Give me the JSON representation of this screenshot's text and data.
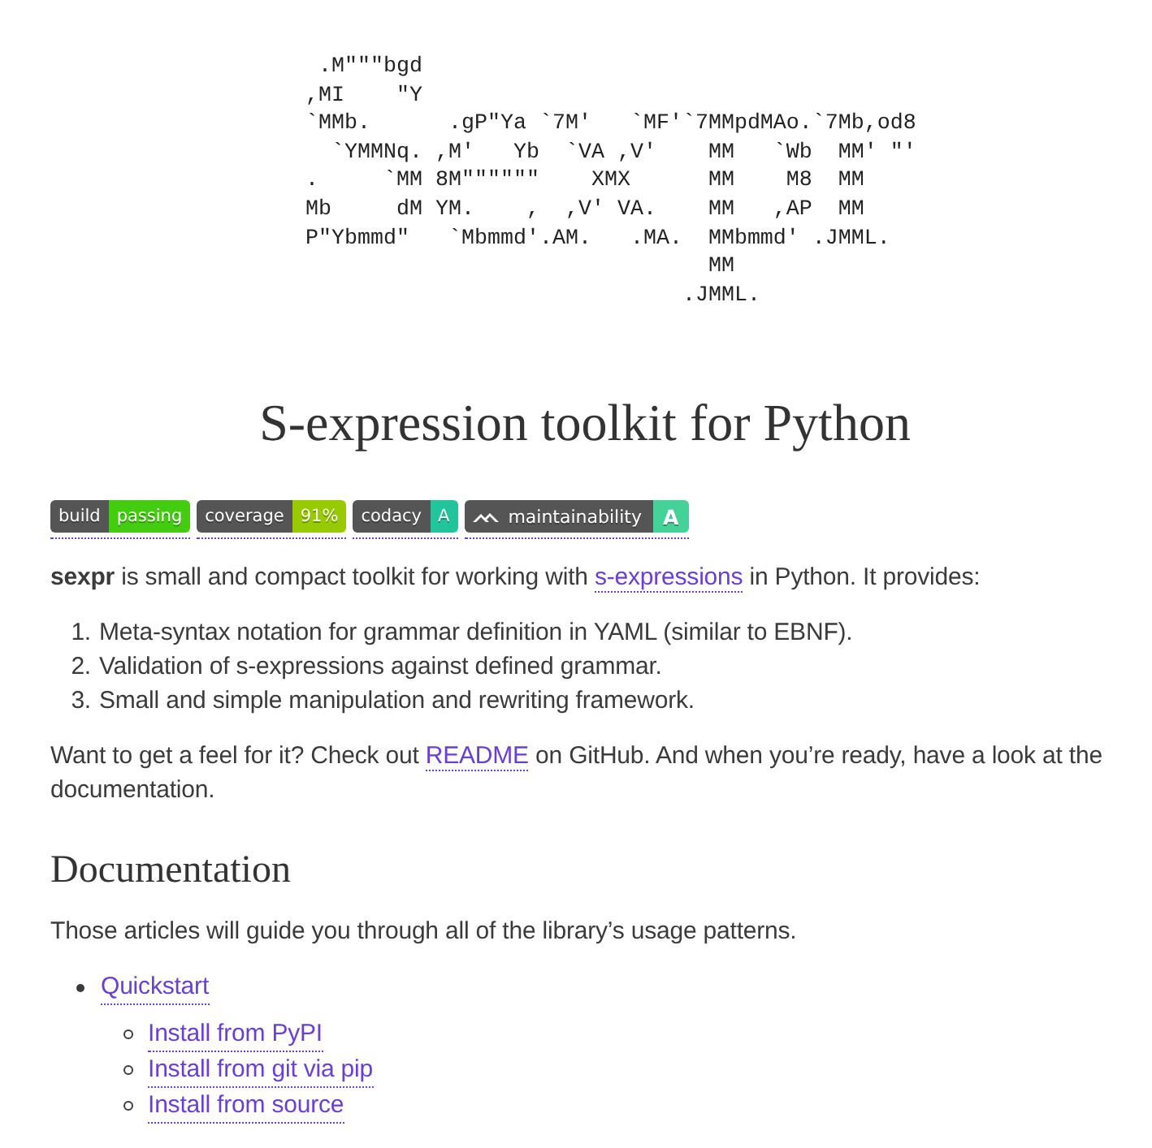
{
  "banner": {
    "ascii_art": [
      " .M\"\"\"bgd",
      ",MI    \"Y",
      "`MMb.      .gP\"Ya `7M'   `MF'`7MMpdMAo.`7Mb,od8",
      "  `YMMNq. ,M'   Yb  `VA ,V'    MM   `Wb  MM' \"'",
      ".     `MM 8M\"\"\"\"\"\"    XMX      MM    M8  MM",
      "Mb     dM YM.    ,  ,V' VA.    MM   ,AP  MM",
      "P\"Ybmmd\"   `Mbmmd'.AM.   .MA.  MMbmmd' .JMML.",
      "                               MM",
      "                             .JMML."
    ]
  },
  "title": "S-expression toolkit for Python",
  "badges": [
    {
      "kind": "plain",
      "label": "build",
      "value": "passing",
      "color": "#44cc11"
    },
    {
      "kind": "plain",
      "label": "coverage",
      "value": "91%",
      "color": "#97ca00"
    },
    {
      "kind": "plain",
      "label": "codacy",
      "value": "A",
      "color": "#22c49b"
    },
    {
      "kind": "icon",
      "label": "maintainability",
      "value": "A",
      "color": "#45d298"
    }
  ],
  "intro": [
    {
      "kind": "text",
      "text": "**sexpr** is small and compact toolkit for working with "
    },
    {
      "kind": "link",
      "text": "s-expressions"
    },
    {
      "kind": "text",
      "text": " in Python. It provides:"
    }
  ],
  "features": [
    {
      "number": "1.",
      "text": "Meta-syntax notation for grammar definition in YAML (similar to EBNF)."
    },
    {
      "number": "2.",
      "text": "Validation of s-expressions against defined grammar."
    },
    {
      "number": "3.",
      "text": "Small and simple manipulation and rewriting framework."
    }
  ],
  "readme": [
    {
      "kind": "text",
      "text": "Want to get a feel for it? Check out "
    },
    {
      "kind": "link",
      "text": "README"
    },
    {
      "kind": "text",
      "text": " on GitHub. And when you’re ready, have a look at the documentation."
    }
  ],
  "documentation": {
    "heading": "Documentation",
    "intro": "Those articles will guide you through all of the library’s usage patterns.",
    "links": [
      {
        "text": "Quickstart",
        "children": [
          {
            "text": "Install from PyPI"
          },
          {
            "text": "Install from git via pip"
          },
          {
            "text": "Install from source"
          }
        ]
      }
    ]
  }
}
